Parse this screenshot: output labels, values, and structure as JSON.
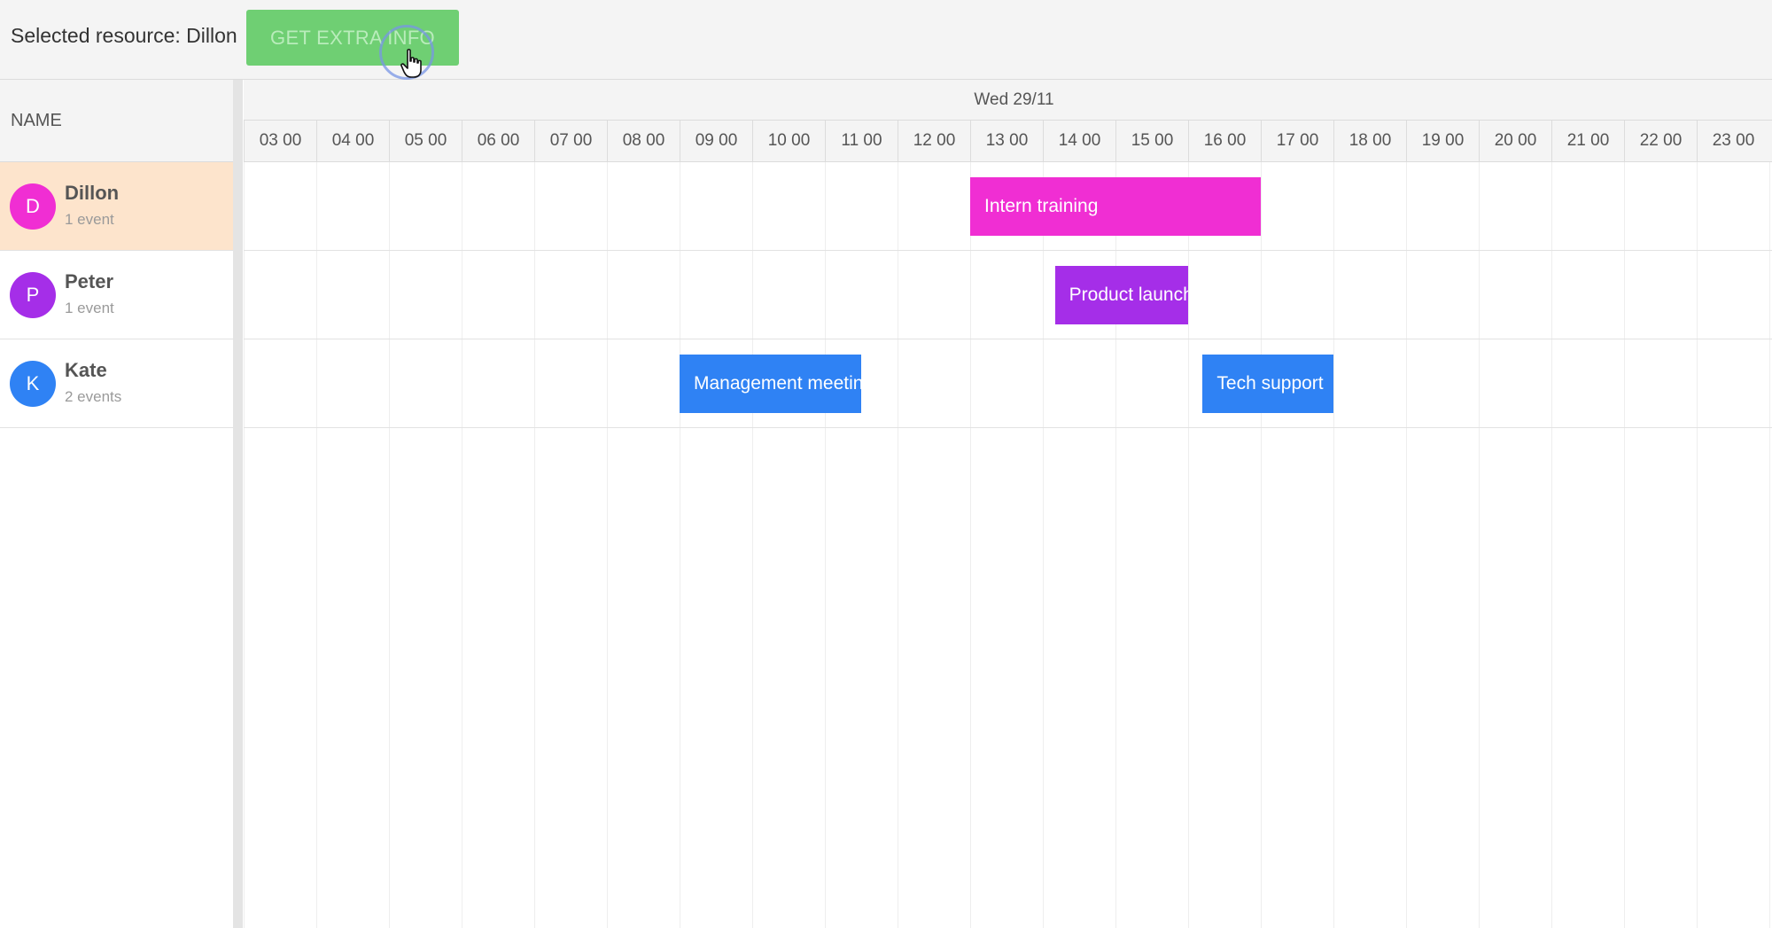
{
  "toolbar": {
    "selected_label": "Selected resource: Dillon",
    "extra_info_button": "GET EXTRA INFO"
  },
  "scheduler": {
    "resource_column_header": "NAME",
    "date_header": "Wed 29/11",
    "hours": [
      "03 00",
      "04 00",
      "05 00",
      "06 00",
      "07 00",
      "08 00",
      "09 00",
      "10 00",
      "11 00",
      "12 00",
      "13 00",
      "14 00",
      "15 00",
      "16 00",
      "17 00",
      "18 00",
      "19 00",
      "20 00",
      "21 00",
      "22 00",
      "23 00"
    ],
    "resources": [
      {
        "initial": "D",
        "name": "Dillon",
        "count": "1 event",
        "color": "#f02ed3",
        "selected": true
      },
      {
        "initial": "P",
        "name": "Peter",
        "count": "1 event",
        "color": "#a52ee8",
        "selected": false
      },
      {
        "initial": "K",
        "name": "Kate",
        "count": "2 events",
        "color": "#2f82f4",
        "selected": false
      }
    ],
    "events": [
      {
        "resource": 0,
        "title": "Intern training",
        "start": "13:00",
        "end": "17:00",
        "color": "#f02ed3"
      },
      {
        "resource": 1,
        "title": "Product launch",
        "start": "14:10",
        "end": "16:00",
        "color": "#a52ee8"
      },
      {
        "resource": 2,
        "title": "Management meeting",
        "start": "09:00",
        "end": "11:30",
        "color": "#2f82f4"
      },
      {
        "resource": 2,
        "title": "Tech support",
        "start": "16:12",
        "end": "18:00",
        "color": "#2f82f4"
      }
    ]
  }
}
